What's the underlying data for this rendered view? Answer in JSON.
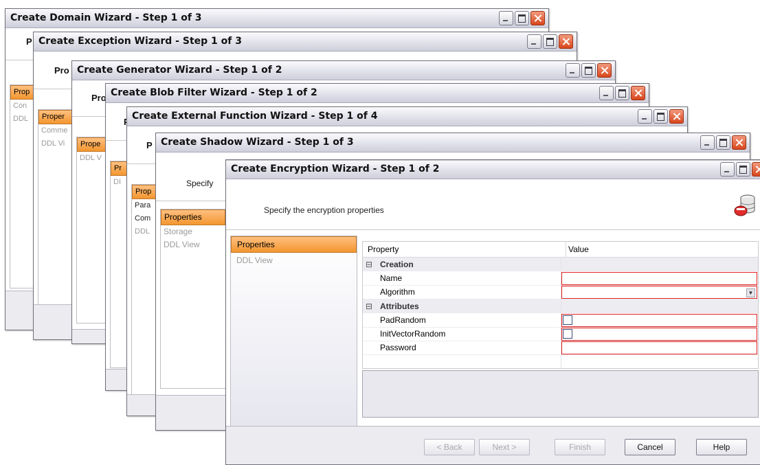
{
  "windows": [
    {
      "title": "Create Domain Wizard - Step 1 of 3",
      "heading_fragment": "P",
      "nav": [
        "Prop",
        "Con",
        "DDL"
      ]
    },
    {
      "title": "Create Exception Wizard - Step 1 of 3",
      "heading_fragment": "Pro",
      "nav": [
        "Proper",
        "Comme",
        "DDL Vi"
      ]
    },
    {
      "title": "Create Generator Wizard - Step 1 of 2",
      "heading_fragment": "Pro",
      "nav": [
        "Prope",
        "DDL V"
      ]
    },
    {
      "title": "Create Blob Filter Wizard - Step 1 of 2",
      "heading_fragment": "Pr",
      "nav": [
        "Pr",
        "DI"
      ]
    },
    {
      "title": "Create External Function Wizard - Step 1 of 4",
      "heading_fragment": "P",
      "nav": [
        "Prop",
        "Para",
        "Com",
        "DDL"
      ]
    },
    {
      "title": "Create Shadow Wizard - Step 1 of 3",
      "heading_fragment": "Specify",
      "nav": [
        "Properties",
        "Storage",
        "DDL View"
      ]
    }
  ],
  "front": {
    "title": "Create Encryption Wizard - Step 1 of 2",
    "heading": "Specify the encryption properties",
    "nav": [
      "Properties",
      "DDL View"
    ],
    "grid": {
      "col_property": "Property",
      "col_value": "Value",
      "rows": [
        {
          "label": "Creation",
          "kind": "category",
          "expander": "⊟"
        },
        {
          "label": "Name",
          "kind": "text"
        },
        {
          "label": "Algorithm",
          "kind": "dropdown"
        },
        {
          "label": "Attributes",
          "kind": "category",
          "expander": "⊟"
        },
        {
          "label": "PadRandom",
          "kind": "checkbox"
        },
        {
          "label": "InitVectorRandom",
          "kind": "checkbox"
        },
        {
          "label": "Password",
          "kind": "text"
        }
      ]
    },
    "buttons": {
      "back": "< Back",
      "next": "Next >",
      "finish": "Finish",
      "cancel": "Cancel",
      "help": "Help"
    }
  },
  "colors": {
    "accent": "#f3962f",
    "required_border": "#e02020",
    "close_button": "#d8461c"
  },
  "icons": {
    "window_min": "minimize-icon",
    "window_max": "maximize-icon",
    "window_close": "close-icon",
    "wizard": "encryption-database-icon"
  }
}
